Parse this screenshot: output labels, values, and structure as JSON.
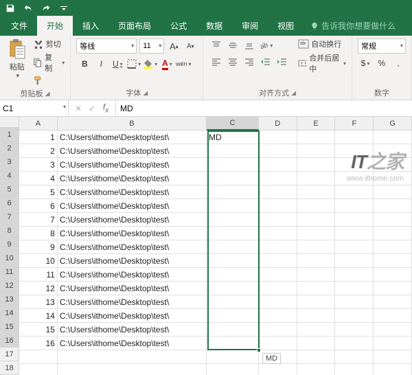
{
  "qat": {
    "save": "保存",
    "undo": "撤销",
    "redo": "重做",
    "more": "自定义"
  },
  "tabs": {
    "file": "文件",
    "home": "开始",
    "insert": "插入",
    "layout": "页面布局",
    "formulas": "公式",
    "data": "数据",
    "review": "审阅",
    "view": "视图",
    "tellme": "告诉我你想要做什么"
  },
  "ribbon": {
    "clipboard": {
      "paste": "粘贴",
      "cut": "剪切",
      "copy": "复制",
      "painter": "",
      "group": "剪贴板"
    },
    "font": {
      "name": "等线",
      "size": "11",
      "increase": "A",
      "decrease": "A",
      "bold": "B",
      "italic": "I",
      "underline": "U",
      "border": "",
      "fill": "",
      "color": "A",
      "phonetic": "wén",
      "group": "字体"
    },
    "alignment": {
      "wrap": "自动换行",
      "merge": "合并后居中",
      "group": "对齐方式"
    },
    "number": {
      "format": "常规",
      "group": "数字"
    }
  },
  "formula_bar": {
    "name_box": "C1",
    "formula": "MD"
  },
  "grid": {
    "col_headers": [
      "A",
      "B",
      "C",
      "D",
      "E",
      "F",
      "G"
    ],
    "row_count": 18,
    "data_rows": 16,
    "a_values": [
      1,
      2,
      3,
      4,
      5,
      6,
      7,
      8,
      9,
      10,
      11,
      12,
      13,
      14,
      15,
      16
    ],
    "b_value": "C:\\Users\\ithome\\Desktop\\test\\",
    "c1": "MD",
    "selection": {
      "col": "C",
      "from_row": 1,
      "to_row": 16,
      "active": "C1"
    },
    "fill_hint": "MD"
  },
  "watermark": {
    "brand_prefix": "IT",
    "brand_suffix": "之家",
    "url": "www.ithome.com"
  }
}
